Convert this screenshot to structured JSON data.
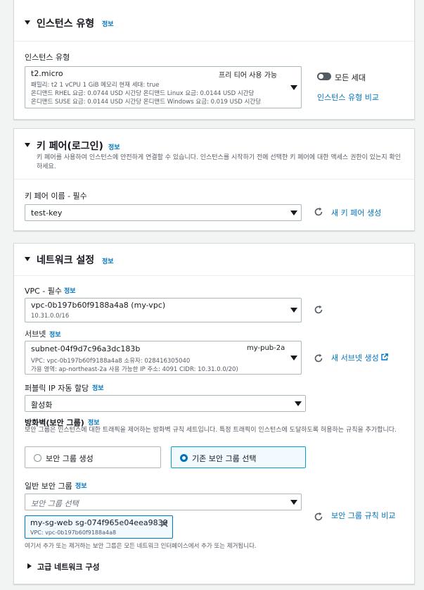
{
  "instance_type": {
    "heading": "인스턴스 유형",
    "info": "정보",
    "field_label": "인스턴스 유형",
    "selected": "t2.micro",
    "free_tier": "프리 티어 사용 가능",
    "details_line1": "패밀리: t2    1 vCPU    1 GiB 메모리    현재 세대: true",
    "details_line2": "온디맨드 RHEL 요금: 0.0744 USD 시간당    온디맨드 Linux 요금: 0.0144 USD 시간당",
    "details_line3": "온디맨드 SUSE 요금: 0.0144 USD 시간당    온디맨드 Windows 요금: 0.019 USD 시간당",
    "all_generations": "모든 세대",
    "compare_link": "인스턴스 유형 비교"
  },
  "key_pair": {
    "heading": "키 페어(로그인)",
    "info": "정보",
    "description": "키 페어를 사용하여 인스턴스에 안전하게 연결할 수 있습니다. 인스턴스를 시작하기 전에 선택한 키 페어에 대한 액세스 권한이 있는지 확인하세요.",
    "field_label": "키 페어 이름 - 필수",
    "selected": "test-key",
    "create_link": "새 키 페어 생성"
  },
  "network": {
    "heading": "네트워크 설정",
    "info": "정보",
    "vpc_label": "VPC - 필수",
    "vpc_info": "정보",
    "vpc_value": "vpc-0b197b60f9188a4a8 (my-vpc)",
    "vpc_cidr": "10.31.0.0/16",
    "subnet_label": "서브넷",
    "subnet_info": "정보",
    "subnet_value": "subnet-04f9d7c96a3dc183b",
    "subnet_name": "my-pub-2a",
    "subnet_line1": "VPC: vpc-0b197b60f9188a4a8      소유자: 028416305040",
    "subnet_line2": "가용 영역: ap-northeast-2a      사용 가능한 IP 주소: 4091      CIDR: 10.31.0.0/20)",
    "create_subnet_link": "새 서브넷 생성",
    "public_ip_label": "퍼블릭 IP 자동 할당",
    "public_ip_info": "정보",
    "public_ip_value": "활성화",
    "firewall_label": "방화벽(보안 그룹)",
    "firewall_info": "정보",
    "firewall_desc": "보안 그룹은 인스턴스에 대한 트래픽을 제어하는 방화벽 규칙 세트입니다. 특정 트래픽이 인스턴스에 도달하도록 허용하는 규칙을 추가합니다.",
    "option_create": "보안 그룹 생성",
    "option_existing": "기존 보안 그룹 선택",
    "common_sg_label": "일반 보안 그룹",
    "common_sg_info": "정보",
    "sg_placeholder": "보안 그룹 선택",
    "compare_rules_link": "보안 그룹 규칙 비교",
    "token_name": "my-sg-web",
    "token_id": "sg-074f965e04eea9839",
    "token_vpc": "VPC: vpc-0b197b60f9188a4a8",
    "sg_note": "여기서 추가 또는 제거하는 보안 그룹은 모든 네트워크 인터페이스에서 추가 또는 제거됩니다.",
    "advanced": "고급 네트워크 구성"
  }
}
